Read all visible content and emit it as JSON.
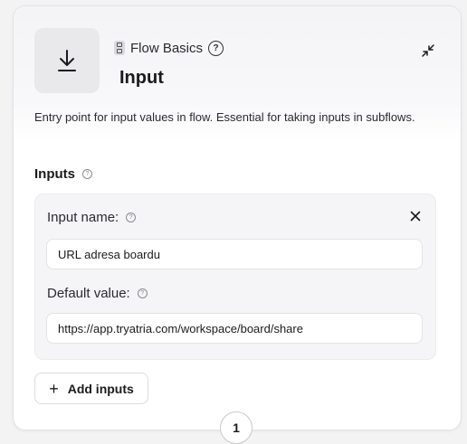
{
  "node": {
    "category": "Flow Basics",
    "title": "Input",
    "description": "Entry point for input values in flow. Essential for taking inputs in subflows.",
    "icons": {
      "node_icon": "download-icon",
      "category_icon": "node-category-icon",
      "help_icon": "help-circle-icon",
      "collapse_icon": "collapse-icon"
    }
  },
  "inputs_section": {
    "heading": "Inputs",
    "items": [
      {
        "name_label": "Input name:",
        "name_value": "URL adresa boardu",
        "default_label": "Default value:",
        "default_value": "https://app.tryatria.com/workspace/board/share"
      }
    ],
    "add_button_label": "Add inputs"
  },
  "connector": {
    "badge": "1"
  }
}
